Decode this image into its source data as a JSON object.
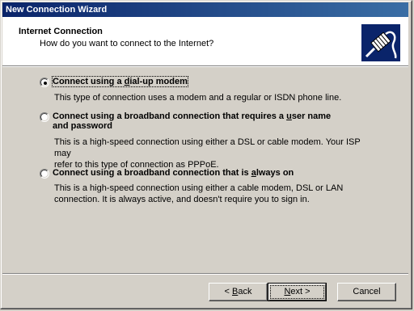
{
  "window": {
    "title": "New Connection Wizard"
  },
  "header": {
    "title": "Internet Connection",
    "subtitle": "How do you want to connect to the Internet?",
    "icon": "network-cable-icon"
  },
  "options": [
    {
      "label_pre": "Connect using a ",
      "label_ul": "d",
      "label_post": "ial-up modem",
      "selected": true,
      "description_lines": [
        "This type of connection uses a modem and a regular or ISDN phone line."
      ]
    },
    {
      "label_pre": "Connect using a broadband connection that requires a ",
      "label_ul": "u",
      "label_post": "ser name",
      "label_line2": "and password",
      "selected": false,
      "description_lines": [
        "This is a high-speed connection using either a DSL or cable modem. Your ISP may",
        "refer to this type of connection as PPPoE."
      ]
    },
    {
      "label_pre": "Connect using a broadband connection that is ",
      "label_ul": "a",
      "label_post": "lways on",
      "selected": false,
      "description_lines": [
        "This is a high-speed connection using either a cable modem, DSL or LAN",
        "connection. It is always active, and doesn't require you to sign in."
      ]
    }
  ],
  "buttons": {
    "back": {
      "pre": "< ",
      "ul": "B",
      "post": "ack"
    },
    "next": {
      "pre": "",
      "ul": "N",
      "post": "ext >"
    },
    "cancel": {
      "label": "Cancel"
    }
  }
}
